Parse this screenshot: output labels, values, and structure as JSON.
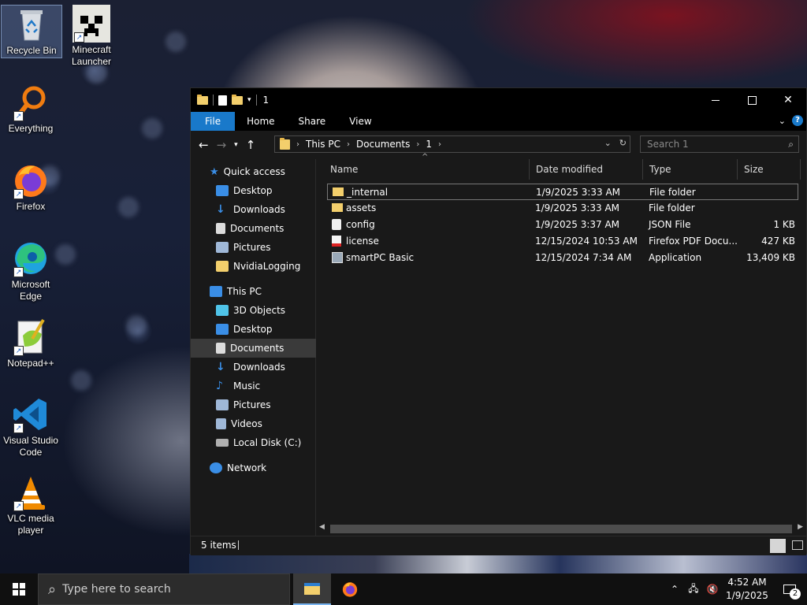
{
  "desktop": {
    "icons": [
      {
        "label": "Recycle Bin",
        "icon": "recycle-bin-icon"
      },
      {
        "label": "Minecraft Launcher",
        "icon": "minecraft-icon"
      },
      {
        "label": "Everything",
        "icon": "magnifier-icon"
      },
      {
        "label": "Firefox",
        "icon": "firefox-icon"
      },
      {
        "label": "Microsoft Edge",
        "icon": "edge-icon"
      },
      {
        "label": "Notepad++",
        "icon": "notepadpp-icon"
      },
      {
        "label": "Visual Studio Code",
        "icon": "vscode-icon"
      },
      {
        "label": "VLC media player",
        "icon": "vlc-icon"
      }
    ]
  },
  "explorer": {
    "title": "1",
    "ribbon": {
      "tabs": [
        "File",
        "Home",
        "Share",
        "View"
      ],
      "help": "?"
    },
    "address": {
      "segments": [
        "This PC",
        "Documents",
        "1"
      ]
    },
    "search": {
      "placeholder": "Search 1"
    },
    "nav_pane": {
      "items": [
        {
          "label": "Quick access",
          "icon": "star-icon",
          "color": "#3a8ee6"
        },
        {
          "label": "Desktop",
          "icon": "desktop-icon",
          "color": "#3a8ee6",
          "pinned": true
        },
        {
          "label": "Downloads",
          "icon": "download-icon",
          "color": "#3a8ee6",
          "pinned": true
        },
        {
          "label": "Documents",
          "icon": "document-icon",
          "color": "#dcdcdc",
          "pinned": true
        },
        {
          "label": "Pictures",
          "icon": "pictures-icon",
          "color": "#9fb8d8",
          "pinned": true
        },
        {
          "label": "NvidiaLogging",
          "icon": "folder-icon",
          "color": "#f3cf6c"
        },
        {
          "label": "This PC",
          "icon": "computer-icon",
          "color": "#3a8ee6"
        },
        {
          "label": "3D Objects",
          "icon": "cube-icon",
          "color": "#4fc3e8"
        },
        {
          "label": "Desktop",
          "icon": "desktop-icon",
          "color": "#3a8ee6"
        },
        {
          "label": "Documents",
          "icon": "document-icon",
          "color": "#dcdcdc"
        },
        {
          "label": "Downloads",
          "icon": "download-icon",
          "color": "#3a8ee6"
        },
        {
          "label": "Music",
          "icon": "music-icon",
          "color": "#3a8ee6"
        },
        {
          "label": "Pictures",
          "icon": "pictures-icon",
          "color": "#9fb8d8"
        },
        {
          "label": "Videos",
          "icon": "video-icon",
          "color": "#9fb8d8"
        },
        {
          "label": "Local Disk (C:)",
          "icon": "disk-icon",
          "color": "#b0b0b0"
        },
        {
          "label": "Network",
          "icon": "network-icon",
          "color": "#3a8ee6"
        }
      ],
      "selected": "Documents"
    },
    "columns": [
      "Name",
      "Date modified",
      "Type",
      "Size"
    ],
    "files": [
      {
        "name": "_internal",
        "date": "1/9/2025 3:33 AM",
        "type": "File folder",
        "size": "",
        "icon": "folder-icon"
      },
      {
        "name": "assets",
        "date": "1/9/2025 3:33 AM",
        "type": "File folder",
        "size": "",
        "icon": "folder-icon"
      },
      {
        "name": "config",
        "date": "1/9/2025 3:37 AM",
        "type": "JSON File",
        "size": "1 KB",
        "icon": "json-file-icon"
      },
      {
        "name": "license",
        "date": "12/15/2024 10:53 AM",
        "type": "Firefox PDF Docu...",
        "size": "427 KB",
        "icon": "pdf-icon"
      },
      {
        "name": "smartPC Basic",
        "date": "12/15/2024 7:34 AM",
        "type": "Application",
        "size": "13,409 KB",
        "icon": "application-icon"
      }
    ],
    "status": "5 items"
  },
  "taskbar": {
    "search_placeholder": "Type here to search",
    "time": "4:52 AM",
    "date": "1/9/2025",
    "notifications": "2"
  },
  "colors": {
    "accent": "#1979ca",
    "folder": "#f3cf6c"
  }
}
